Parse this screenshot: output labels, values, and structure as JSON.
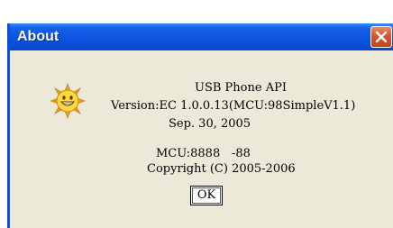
{
  "window": {
    "title": "About"
  },
  "about": {
    "product": "USB Phone API",
    "version": "Version:EC 1.0.0.13(MCU:98SimpleV1.1)",
    "date": "Sep. 30, 2005",
    "mcu_label": "MCU:8888",
    "mcu_value": "-88",
    "copyright": "Copyright (C) 2005-2006"
  },
  "buttons": {
    "ok_label": "OK"
  },
  "icons": {
    "app": "smiley-sun-icon",
    "close": "close-icon"
  },
  "colors": {
    "titlebar": "#0a55df",
    "close_button": "#d8542c",
    "dialog_bg": "#ece9d8"
  }
}
